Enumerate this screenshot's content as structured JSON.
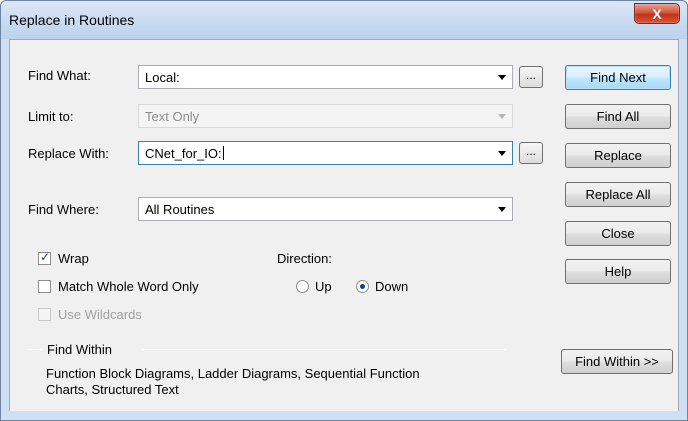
{
  "window": {
    "title": "Replace in Routines",
    "close_label": "X"
  },
  "form": {
    "find_what_label": "Find What:",
    "find_what_value": "Local:",
    "limit_to_label": "Limit to:",
    "limit_to_value": "Text Only",
    "replace_with_label": "Replace With:",
    "replace_with_value": "CNet_for_IO:",
    "find_where_label": "Find Where:",
    "find_where_value": "All Routines",
    "browse_label": "..."
  },
  "options": {
    "wrap_label": "Wrap",
    "wrap_checked": true,
    "match_whole_word_label": "Match Whole Word Only",
    "match_whole_word_checked": false,
    "use_wildcards_label": "Use Wildcards",
    "use_wildcards_checked": false,
    "direction_label": "Direction:",
    "up_label": "Up",
    "down_label": "Down",
    "direction_selected": "Down"
  },
  "find_within": {
    "label": "Find Within",
    "text_line1": "Function Block Diagrams, Ladder Diagrams, Sequential Function",
    "text_line2": "Charts, Structured Text"
  },
  "buttons": {
    "find_next": "Find Next",
    "find_all": "Find All",
    "replace": "Replace",
    "replace_all": "Replace All",
    "close": "Close",
    "help": "Help",
    "find_within": "Find Within >>"
  }
}
